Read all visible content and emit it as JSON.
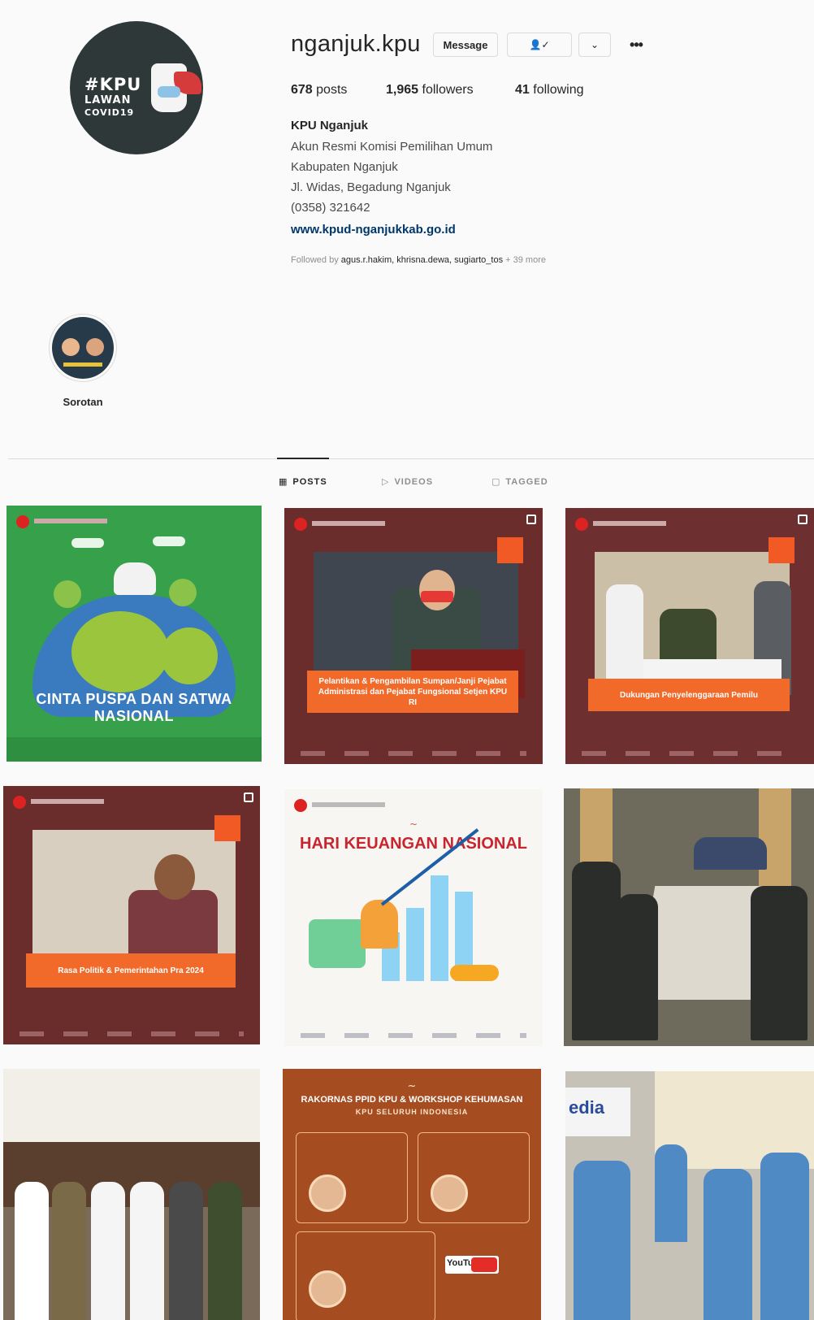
{
  "profile": {
    "username": "nganjuk.kpu",
    "avatar_text": [
      "#KPU",
      "LAWAN",
      "COVID19"
    ],
    "buttons": {
      "message": "Message"
    },
    "stats": {
      "posts_count": "678",
      "posts_label": "posts",
      "followers_count": "1,965",
      "followers_label": "followers",
      "following_count": "41",
      "following_label": "following"
    },
    "full_name": "KPU Nganjuk",
    "bio_lines": [
      "Akun Resmi Komisi Pemilihan Umum",
      "Kabupaten Nganjuk",
      "Jl. Widas, Begadung Nganjuk",
      "(0358) 321642"
    ],
    "website": "www.kpud-nganjukkab.go.id",
    "followed_by": {
      "prefix": "Followed by",
      "names": "agus.r.hakim, khrisna.dewa, sugiarto_tos",
      "suffix": "+ 39 more"
    }
  },
  "highlight": {
    "label": "Sorotan"
  },
  "tabs": [
    {
      "label": "POSTS",
      "icon": "grid-icon",
      "active": true
    },
    {
      "label": "VIDEOS",
      "icon": "video-icon",
      "active": false
    },
    {
      "label": "TAGGED",
      "icon": "tag-icon",
      "active": false
    }
  ],
  "posts": [
    {
      "title": "CINTA PUSPA DAN SATWA NASIONAL"
    },
    {
      "caption": "Pelantikan & Pengambilan Sumpan/Janji Pejabat Administrasi dan Pejabat Fungsional Setjen KPU RI"
    },
    {
      "caption": "Dukungan Penyelenggaraan Pemilu"
    },
    {
      "caption": "Rasa Politik & Pemerintahan Pra 2024"
    },
    {
      "title": "HARI KEUANGAN NASIONAL"
    },
    {},
    {},
    {
      "title": "RAKORNAS PPID KPU & WORKSHOP KEHUMASAN",
      "subtitle": "KPU SELURUH INDONESIA",
      "brand": "YouTube"
    },
    {
      "sign": "edia"
    }
  ],
  "colors": {
    "accent_link": "#00376b",
    "maroon": "#6b2c2c",
    "orange": "#f26a2a",
    "green": "#37a04a"
  }
}
